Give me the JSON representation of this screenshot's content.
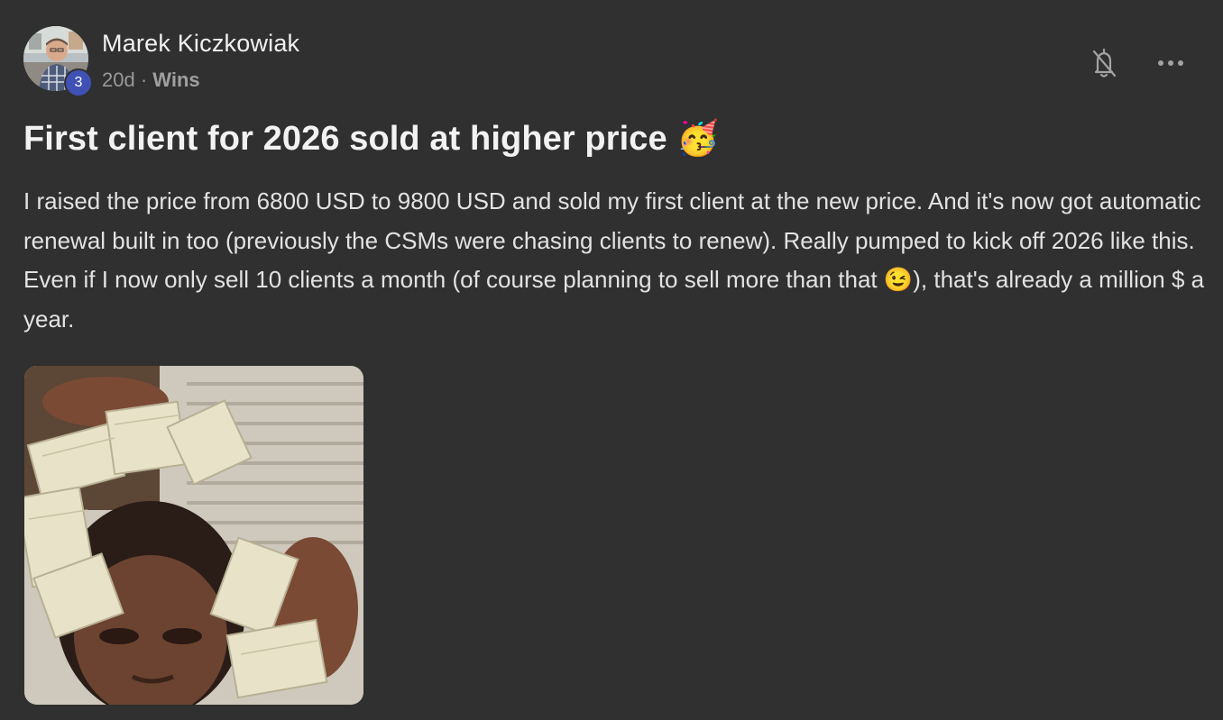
{
  "author": {
    "name": "Marek Kiczkowiak",
    "level": "3",
    "avatar_icon": "avatar-photo"
  },
  "meta": {
    "age": "20d",
    "separator": "·",
    "category": "Wins"
  },
  "actions": {
    "notify_icon": "bell-off-icon",
    "more_icon": "more-horizontal-icon"
  },
  "post": {
    "title": "First client for 2026 sold at higher price",
    "title_emoji": "🥳",
    "body_part1": "I raised the price from 6800 USD to 9800 USD and sold my first client at the new price. And it's now got automatic renewal built in too (previously the CSMs were chasing clients to renew). Really pumped to kick off 2026 like this. Even if I now only sell 10 clients a month (of course planning to sell more than that ",
    "body_emoji": "😉",
    "body_part2": "), that's already a million $ a year."
  },
  "media": {
    "type": "gif",
    "description_icon": "money-gif-image"
  },
  "colors": {
    "background": "#303030",
    "text": "#e6e6e6",
    "muted": "#9a9a9a",
    "badge": "#3f51b5"
  }
}
